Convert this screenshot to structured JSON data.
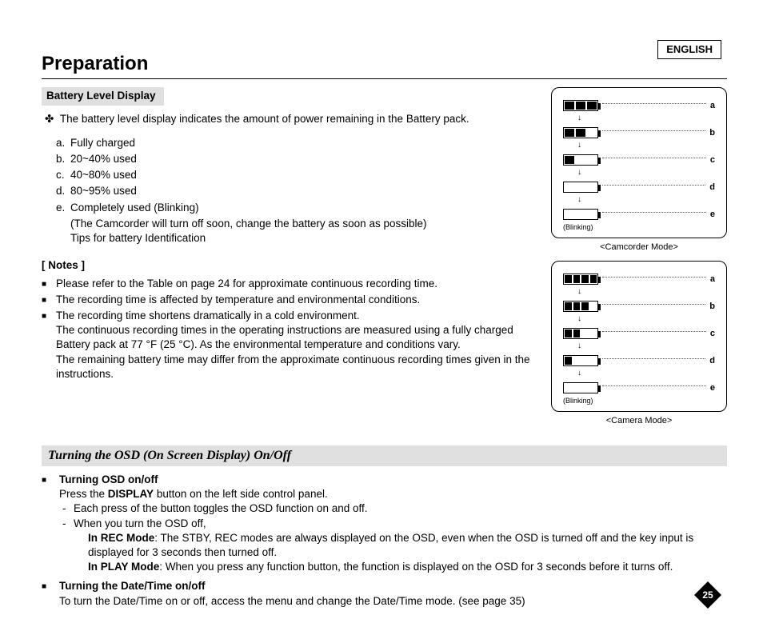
{
  "lang": "ENGLISH",
  "title": "Preparation",
  "section": "Battery Level Display",
  "intro_bullet": "✤",
  "intro": "The battery level display indicates the amount of power remaining in the Battery pack.",
  "levels": {
    "a": "Fully charged",
    "b": "20~40% used",
    "c": "40~80% used",
    "d": "80~95% used",
    "e": "Completely used (Blinking)",
    "e_cont1": "(The Camcorder will turn off soon, change the battery as soon as possible)",
    "e_cont2": "Tips for battery Identification"
  },
  "notes_title": "[ Notes ]",
  "notes": [
    "Please refer to the Table on page 24 for approximate continuous recording time.",
    "The recording time is affected by temperature and environmental conditions.",
    "The recording time shortens dramatically in a cold environment.",
    "The continuous recording times in the operating instructions are measured using a fully charged Battery pack at 77 °F (25 °C). As the environmental temperature and conditions vary.",
    "The remaining battery time may differ from the approximate continuous recording times given in the instructions."
  ],
  "osd_heading": "Turning the OSD (On Screen Display) On/Off",
  "osd1": {
    "title": "Turning OSD on/off",
    "line1_pre": "Press the ",
    "line1_bold": "DISPLAY",
    "line1_post": " button on the left side control panel.",
    "dash1": "Each press of the button toggles the OSD function on and off.",
    "dash2": "When you turn the OSD off,",
    "rec_bold": "In REC Mode",
    "rec_text": ": The STBY, REC modes are always displayed on the OSD, even when the OSD is turned off and the key input is displayed for 3 seconds then turned off.",
    "play_bold": "In PLAY Mode",
    "play_text": ": When you press any function button, the function is displayed on the OSD for 3 seconds before it turns off."
  },
  "osd2": {
    "title": "Turning the Date/Time on/off",
    "text": "To turn the Date/Time on or off, access the menu and change the Date/Time mode. (see page 35)"
  },
  "diagram": {
    "labels": [
      "a",
      "b",
      "c",
      "d",
      "e"
    ],
    "blinking": "(Blinking)",
    "caption1": "<Camcorder Mode>",
    "caption2": "<Camera Mode>"
  },
  "page_number": "25"
}
